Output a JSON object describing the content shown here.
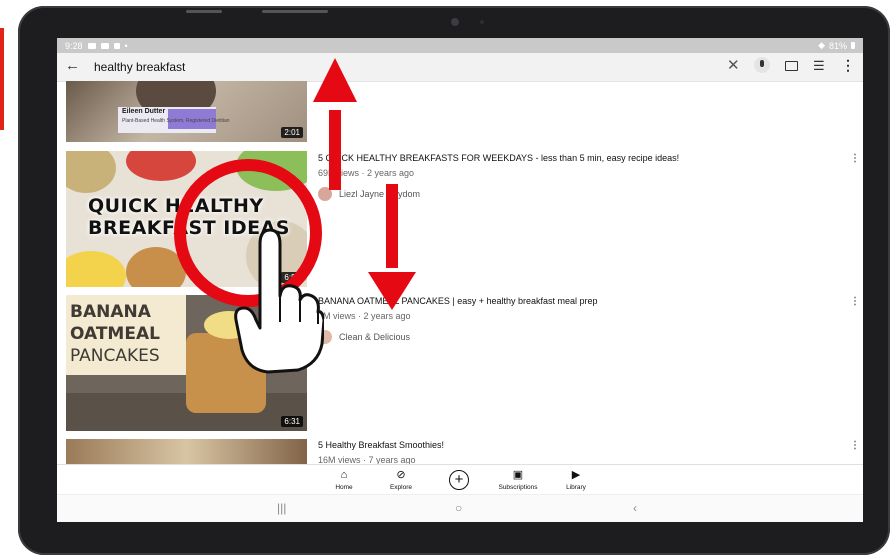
{
  "status_bar": {
    "time": "9:28",
    "battery": "81%"
  },
  "search": {
    "query": "healthy breakfast"
  },
  "videos": [
    {
      "thumb_name": "Eileen Dutter",
      "thumb_sub": "Plant-Based Health System, Registered Dietitian",
      "duration": "2:01"
    },
    {
      "title": "5 QUICK HEALTHY BREAKFASTS FOR WEEKDAYS - less than 5 min, easy recipe ideas!",
      "stats": "69K views · 2 years ago",
      "channel": "Liezl Jayne Strydom",
      "thumb_text_1": "QUICK HEALTHY",
      "thumb_text_2": "BREAKFAST IDEAS",
      "duration": "6:56"
    },
    {
      "title": "BANANA OATMEAL PANCAKES | easy + healthy breakfast meal prep",
      "stats": "3M views · 2 years ago",
      "channel": "Clean & Delicious",
      "thumb_text_1": "BANANA",
      "thumb_text_2": "OATMEAL",
      "thumb_text_3": "PANCAKES",
      "duration": "6:31"
    },
    {
      "title": "5 Healthy Breakfast Smoothies!",
      "stats": "16M views · 7 years ago"
    }
  ],
  "bottom_nav": {
    "home": "Home",
    "explore": "Explore",
    "subscriptions": "Subscriptions",
    "library": "Library"
  },
  "colors": {
    "overlay_red": "#e50914",
    "status_bar": "#c9c9c9",
    "search_bar": "#f2f2f2"
  }
}
